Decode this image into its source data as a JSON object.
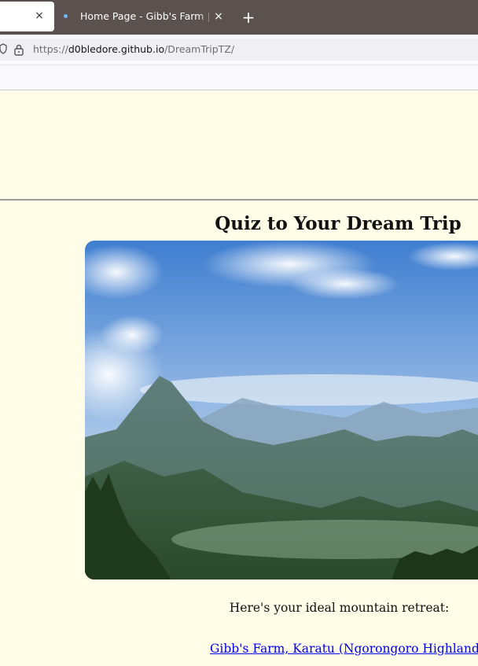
{
  "browser": {
    "tabs": [
      {
        "title": "",
        "active": true
      },
      {
        "title": "Home Page - Gibb's Farm | A",
        "active": false
      }
    ],
    "new_tab_symbol": "+",
    "close_symbol": "×",
    "url": {
      "scheme": "https://",
      "host": "d0bledore.github.io",
      "path": "/DreamTripTZ/"
    }
  },
  "page": {
    "title": "Quiz to Your Dream Trip",
    "hero_image_alt": "Mountain landscape",
    "result_label": "Here's your ideal mountain retreat:",
    "result_link": "Gibb's Farm, Karatu (Ngorongoro Highlands)"
  },
  "colors": {
    "page_background": "#fffde7",
    "tabbar_background": "#5b5250",
    "link": "#0000ee"
  }
}
